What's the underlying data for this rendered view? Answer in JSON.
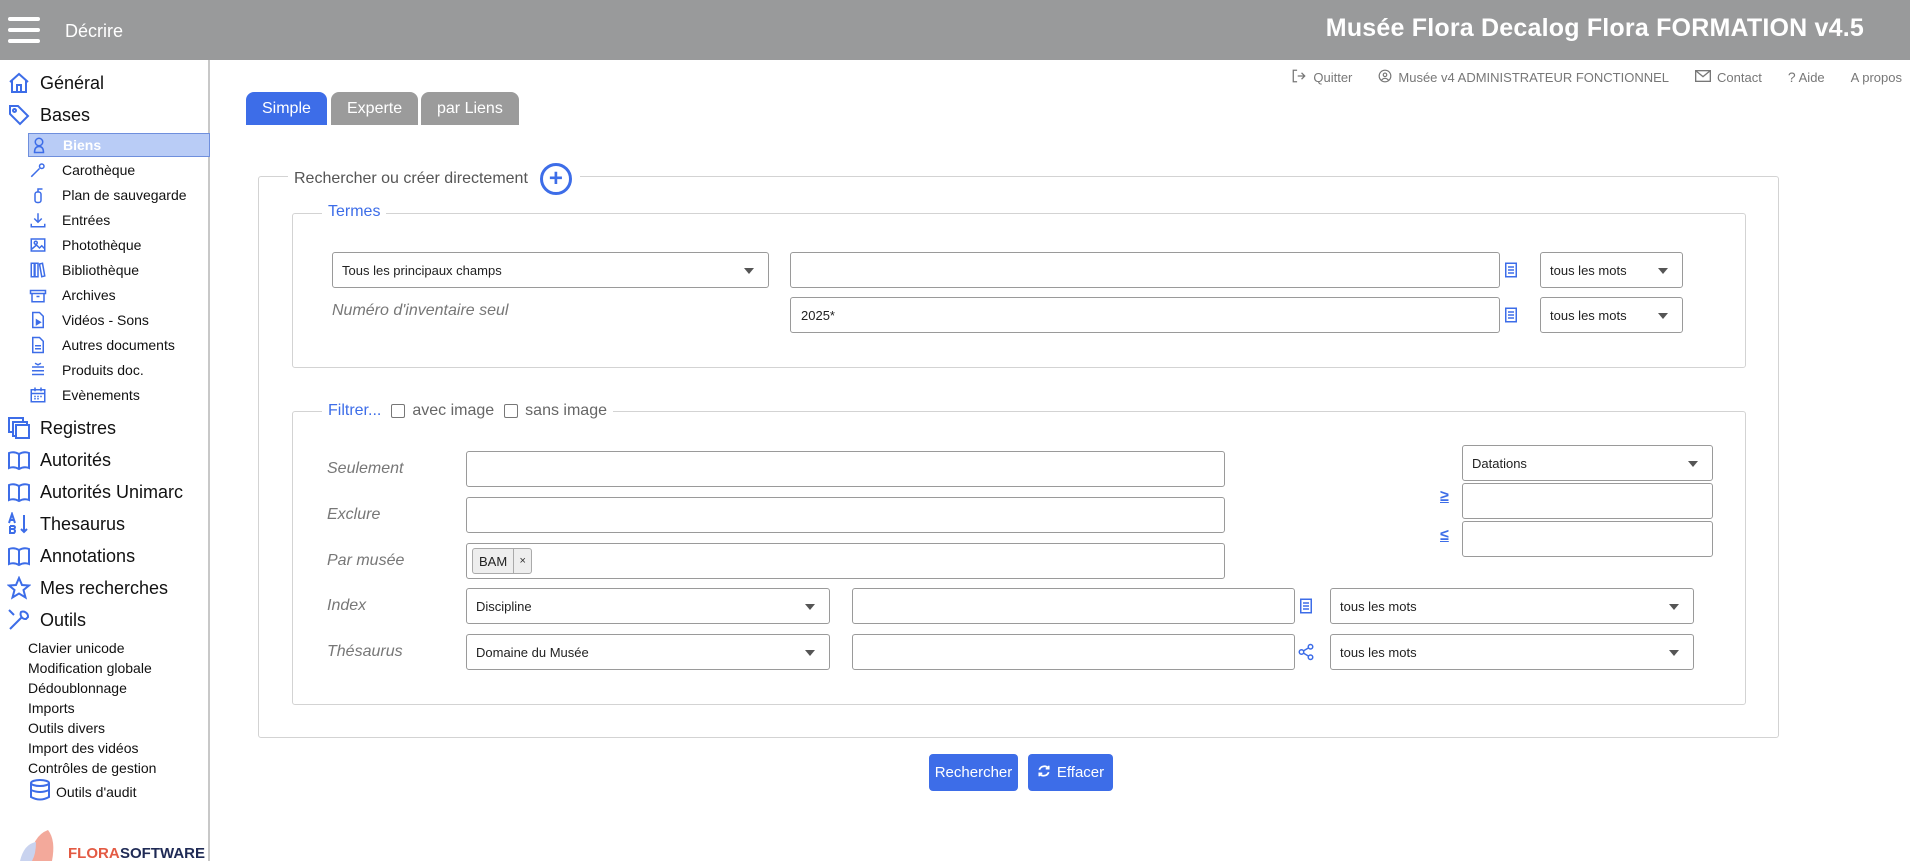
{
  "header": {
    "section": "Décrire",
    "app_title": "Musée Flora Decalog Flora FORMATION v4.5"
  },
  "sidebar": {
    "main_top": [
      {
        "label": "Général",
        "icon": "home-icon"
      },
      {
        "label": "Bases",
        "icon": "tag-icon"
      }
    ],
    "bases_items": [
      {
        "label": "Biens",
        "icon": "bust-icon",
        "active": true
      },
      {
        "label": "Carothèque",
        "icon": "pipette-icon"
      },
      {
        "label": "Plan de sauvegarde",
        "icon": "extinguisher-icon"
      },
      {
        "label": "Entrées",
        "icon": "download-icon"
      },
      {
        "label": "Photothèque",
        "icon": "image-icon"
      },
      {
        "label": "Bibliothèque",
        "icon": "books-icon"
      },
      {
        "label": "Archives",
        "icon": "box-icon"
      },
      {
        "label": "Vidéos - Sons",
        "icon": "video-file-icon"
      },
      {
        "label": "Autres documents",
        "icon": "document-icon"
      },
      {
        "label": "Produits doc.",
        "icon": "layers-icon"
      },
      {
        "label": "Evènements",
        "icon": "calendar-icon"
      }
    ],
    "main_bottom": [
      {
        "label": "Registres",
        "icon": "stack-icon"
      },
      {
        "label": "Autorités",
        "icon": "open-book-icon"
      },
      {
        "label": "Autorités Unimarc",
        "icon": "open-book-icon"
      },
      {
        "label": "Thesaurus",
        "icon": "sort-alpha-icon"
      },
      {
        "label": "Annotations",
        "icon": "open-book-icon"
      },
      {
        "label": "Mes recherches",
        "icon": "star-icon"
      },
      {
        "label": "Outils",
        "icon": "wrench-icon"
      }
    ],
    "tools": [
      "Clavier unicode",
      "Modification globale",
      "Dédoublonnage",
      "Imports",
      "Outils divers",
      "Import des vidéos",
      "Contrôles de gestion",
      "Outils d'audit"
    ],
    "logo_text": "FLORA SOFTWARE"
  },
  "userbar": {
    "quit": "Quitter",
    "user": "Musée v4 ADMINISTRATEUR FONCTIONNEL",
    "contact": "Contact",
    "help": "Aide",
    "about": "A propos"
  },
  "tabs": [
    {
      "label": "Simple",
      "active": true
    },
    {
      "label": "Experte",
      "active": false
    },
    {
      "label": "par Liens",
      "active": false
    }
  ],
  "search": {
    "legend": "Rechercher ou créer directement",
    "termes": {
      "legend": "Termes",
      "field_select": "Tous les principaux champs",
      "field_value": "",
      "mode1": "tous les mots",
      "inventory_label": "Numéro d'inventaire seul",
      "inventory_value": "2025*",
      "mode2": "tous les mots"
    },
    "filter": {
      "legend": "Filtrer...",
      "with_image": "avec image",
      "without_image": "sans image",
      "only_label": "Seulement",
      "exclude_label": "Exclure",
      "museum_label": "Par musée",
      "museum_chip": "BAM",
      "chip_remove": "×",
      "index_label": "Index",
      "index_select": "Discipline",
      "index_mode": "tous les mots",
      "thesaurus_label": "Thésaurus",
      "thesaurus_select": "Domaine du Musée",
      "thesaurus_mode": "tous les mots",
      "date_select": "Datations",
      "gte_symbol": "≥",
      "lte_symbol": "≤"
    }
  },
  "buttons": {
    "search": "Rechercher",
    "clear": "Effacer"
  },
  "colors": {
    "primary": "#3d6de8",
    "topbar": "#999a9b",
    "inactive_tab": "#9b9b9b",
    "active_nav_bg": "#b9ccf6"
  }
}
